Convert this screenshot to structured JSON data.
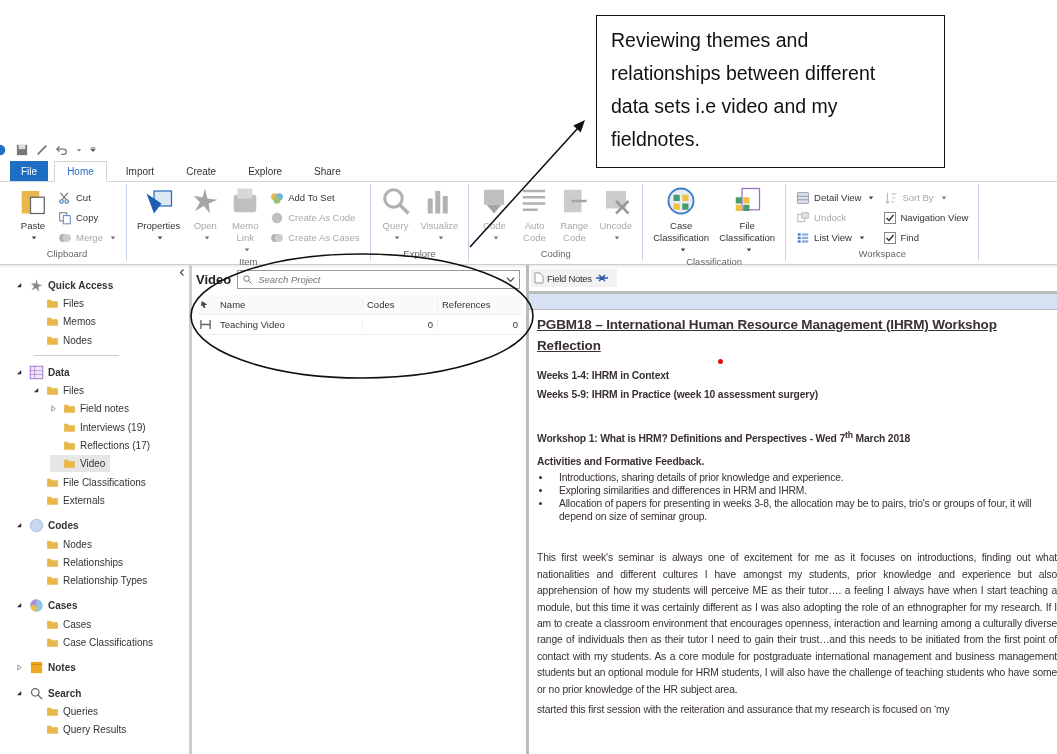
{
  "annotation": {
    "text": "Reviewing themes and relationships between different data sets i.e video and my fieldnotes."
  },
  "ribbon_tabs": [
    {
      "label": "File",
      "kind": "file",
      "selected": false
    },
    {
      "label": "Home",
      "kind": "tab",
      "selected": true
    },
    {
      "label": "Import",
      "kind": "tab",
      "selected": false
    },
    {
      "label": "Create",
      "kind": "tab",
      "selected": false
    },
    {
      "label": "Explore",
      "kind": "tab",
      "selected": false
    },
    {
      "label": "Share",
      "kind": "tab",
      "selected": false
    }
  ],
  "ribbon_groups": [
    {
      "label": "Clipboard",
      "items": [
        {
          "kind": "large",
          "label": "Paste",
          "dropdown": true,
          "disabled": false
        },
        {
          "kind": "small",
          "label": "Cut",
          "dropdown": false,
          "disabled": false
        },
        {
          "kind": "small",
          "label": "Copy",
          "dropdown": false,
          "disabled": false
        },
        {
          "kind": "small",
          "label": "Merge",
          "dropdown": true,
          "disabled": true
        }
      ]
    },
    {
      "label": "Item",
      "items": [
        {
          "kind": "large",
          "label": "Properties",
          "dropdown": true,
          "disabled": false
        },
        {
          "kind": "large",
          "label": "Open",
          "dropdown": true,
          "disabled": true
        },
        {
          "kind": "large",
          "label": "Memo Link",
          "dropdown": true,
          "disabled": true
        },
        {
          "kind": "small",
          "label": "Add To Set",
          "dropdown": false,
          "disabled": false
        },
        {
          "kind": "small",
          "label": "Create As Code",
          "dropdown": false,
          "disabled": true
        },
        {
          "kind": "small",
          "label": "Create As Cases",
          "dropdown": false,
          "disabled": true
        }
      ]
    },
    {
      "label": "Explore",
      "items": [
        {
          "kind": "large",
          "label": "Query",
          "dropdown": true,
          "disabled": true
        },
        {
          "kind": "large",
          "label": "Visualize",
          "dropdown": true,
          "disabled": true
        }
      ]
    },
    {
      "label": "Coding",
      "items": [
        {
          "kind": "large",
          "label": "Code",
          "dropdown": true,
          "disabled": true
        },
        {
          "kind": "large",
          "label": "Auto Code",
          "dropdown": false,
          "disabled": true
        },
        {
          "kind": "large",
          "label": "Range Code",
          "dropdown": false,
          "disabled": true
        },
        {
          "kind": "large",
          "label": "Uncode",
          "dropdown": true,
          "disabled": true
        }
      ]
    },
    {
      "label": "Classification",
      "items": [
        {
          "kind": "large",
          "label": "Case Classification",
          "dropdown": true,
          "disabled": false
        },
        {
          "kind": "large",
          "label": "File Classification",
          "dropdown": true,
          "disabled": false
        }
      ]
    },
    {
      "label": "Workspace",
      "items": [
        {
          "kind": "small",
          "label": "Detail View",
          "dropdown": true,
          "disabled": false
        },
        {
          "kind": "small",
          "label": "Undock",
          "dropdown": false,
          "disabled": true
        },
        {
          "kind": "small",
          "label": "List View",
          "dropdown": true,
          "disabled": false
        },
        {
          "kind": "small",
          "label": "Sort By",
          "dropdown": true,
          "disabled": true
        },
        {
          "kind": "check",
          "label": "Navigation View",
          "checked": true
        },
        {
          "kind": "check",
          "label": "Find",
          "checked": true
        }
      ]
    }
  ],
  "navigation": {
    "sections": [
      {
        "label": "Quick Access",
        "expanded": true,
        "selected": false,
        "children": [
          {
            "label": "Files",
            "selected": false
          },
          {
            "label": "Memos",
            "selected": false
          },
          {
            "label": "Nodes",
            "selected": false
          }
        ]
      },
      {
        "label": "Data",
        "expanded": true,
        "selected": false,
        "children": [
          {
            "label": "Files",
            "expanded": true,
            "selected": false,
            "children": [
              {
                "label": "Field notes",
                "expanded": false,
                "selected": false
              },
              {
                "label": "Interviews (19)",
                "selected": false
              },
              {
                "label": "Reflections (17)",
                "selected": false
              },
              {
                "label": "Video",
                "selected": true
              }
            ]
          },
          {
            "label": "File Classifications",
            "selected": false
          },
          {
            "label": "Externals",
            "selected": false
          }
        ]
      },
      {
        "label": "Codes",
        "expanded": true,
        "selected": false,
        "children": [
          {
            "label": "Nodes",
            "selected": false
          },
          {
            "label": "Relationships",
            "selected": false
          },
          {
            "label": "Relationship Types",
            "selected": false
          }
        ]
      },
      {
        "label": "Cases",
        "expanded": true,
        "selected": false,
        "children": [
          {
            "label": "Cases",
            "selected": false
          },
          {
            "label": "Case Classifications",
            "selected": false
          }
        ]
      },
      {
        "label": "Notes",
        "expanded": false,
        "selected": false
      },
      {
        "label": "Search",
        "expanded": true,
        "selected": false,
        "children": [
          {
            "label": "Queries",
            "selected": false
          },
          {
            "label": "Query Results",
            "selected": false
          }
        ]
      }
    ]
  },
  "list_view": {
    "title": "Video",
    "search": {
      "placeholder": "Search Project"
    },
    "table": {
      "columns": [
        "Name",
        "Codes",
        "References"
      ],
      "rows": [
        {
          "cells": [
            "Teaching Video",
            "0",
            "0"
          ]
        }
      ]
    }
  },
  "document": {
    "tab": {
      "label": "Field Notes"
    },
    "blocks": [
      {
        "kind": "title",
        "text": "PGBM18 – International Human Resource Management (IHRM) Workshop Reflection"
      },
      {
        "kind": "bold",
        "text": "Weeks 1-4: IHRM in Context"
      },
      {
        "kind": "bold",
        "text": "Weeks 5-9: IHRM in Practice (week 10 assessment surgery)"
      },
      {
        "kind": "heading",
        "text": "Workshop 1: What is HRM? Definitions and Perspectives -  Wed 7$^{th}$ March 2018"
      },
      {
        "kind": "bold",
        "text": "Activities and Formative Feedback."
      },
      {
        "kind": "bullets",
        "items": [
          "Introductions, sharing details of prior knowledge and experience.",
          "Exploring similarities and differences in HRM and IHRM.",
          "Allocation of papers for presenting in weeks 3-8, the allocation may be to pairs, trio's   or groups of four, it will depend on size of seminar group."
        ]
      },
      {
        "kind": "paragraph",
        "text": "This first week's seminar is always one of excitement for me as it focuses on introductions, finding out what nationalities and different cultures I have amongst my students, prior knowledge and experience but also apprehension of how my students will perceive ME as their tutor…. a feeling I always have when I start teaching a module, but this time it was certainly different as I was also adopting the role of an ethnographer for my research.   If I am to create a classroom environment that encourages openness, interaction and learning among a culturally diverse range of individuals then as their tutor I need to gain their trust…and this needs to be initiated from the first point of contact with my students.  As a core module for postgraduate international management and business management students but an optional module for HRM students, I will also have the challenge of teaching students who have some or no prior knowledge of the HR subject area."
      },
      {
        "kind": "paragraph",
        "text": "started this first session with the reiteration and assurance that my research is focused on ‘my"
      }
    ]
  }
}
